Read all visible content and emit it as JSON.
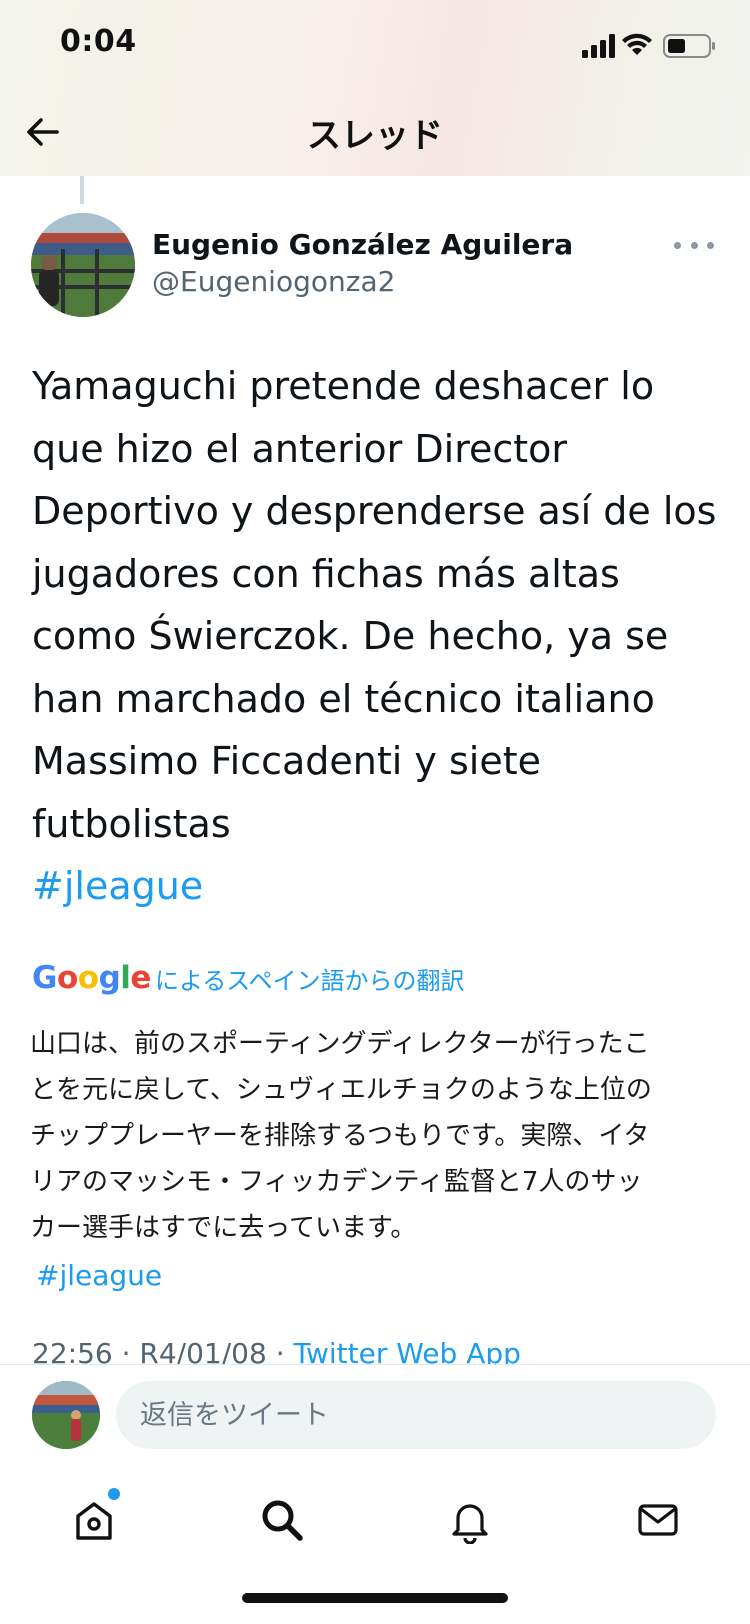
{
  "status_bar": {
    "time": "0:04"
  },
  "nav": {
    "title": "スレッド",
    "back_icon": "arrow-left-icon"
  },
  "tweet": {
    "author_name": "Eugenio González Aguilera",
    "author_handle": "@Eugeniogonza2",
    "text": "Yamaguchi pretende deshacer lo\nque hizo el anterior Director\nDeportivo y desprenderse así de los\njugadores con fichas más altas\ncomo Świerczok. De hecho, ya se\nhan marchado el técnico italiano\nMassimo Ficcadenti y siete\nfutbolistas",
    "hashtag": "#jleague",
    "timestamp": "22:56 · R4/01/08 · ",
    "source": "Twitter Web App"
  },
  "translation": {
    "provider": "Google",
    "label": "によるスペイン語からの翻訳",
    "text": "山口は、前のスポーティングディレクターが行ったこ\nとを元に戻して、シュヴィエルチョクのような上位の\nチッププレーヤーを排除するつもりです。実際、イタ\nリアのマッシモ・フィッカデンティ監督と7人のサッ\nカー選手はすでに去っています。",
    "hashtag": "#jleague"
  },
  "reply": {
    "placeholder": "返信をツイート"
  },
  "tabs": [
    {
      "name": "home",
      "icon": "home-icon",
      "has_notification": true
    },
    {
      "name": "search",
      "icon": "search-icon"
    },
    {
      "name": "notifications",
      "icon": "bell-icon"
    },
    {
      "name": "messages",
      "icon": "mail-icon"
    }
  ],
  "colors": {
    "link": "#1d9bf0",
    "text": "#0f1419",
    "secondary": "#536471"
  }
}
